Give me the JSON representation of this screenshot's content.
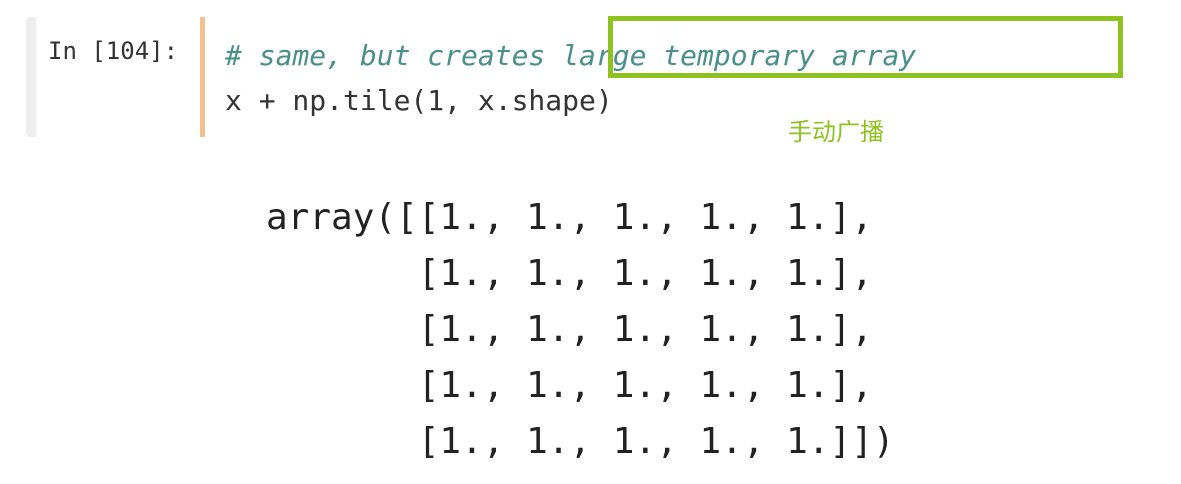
{
  "cell": {
    "prompt": "In [104]:",
    "comment_line": "# same, but creates large temporary array",
    "code_line": "x + np.tile(1, x.shape)"
  },
  "annotation": {
    "text": "手动广播",
    "color": "#8dc21f"
  },
  "output": {
    "lines": [
      "array([[1., 1., 1., 1., 1.],",
      "       [1., 1., 1., 1., 1.],",
      "       [1., 1., 1., 1., 1.],",
      "       [1., 1., 1., 1., 1.],",
      "       [1., 1., 1., 1., 1.]])"
    ]
  },
  "colors": {
    "comment": "#4a8f8a",
    "input_border": "#f5c08f",
    "highlight": "#8dc21f"
  }
}
